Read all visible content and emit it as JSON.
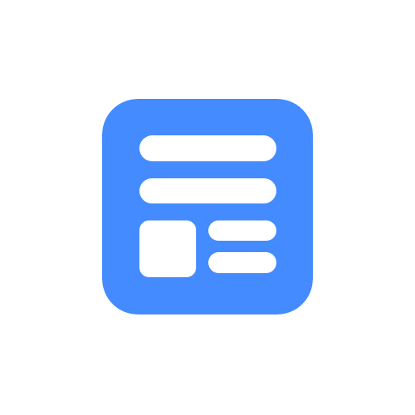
{
  "icon": {
    "name": "news-layout-icon",
    "background_color": "#448BFF",
    "foreground_color": "#FFFFFF"
  }
}
